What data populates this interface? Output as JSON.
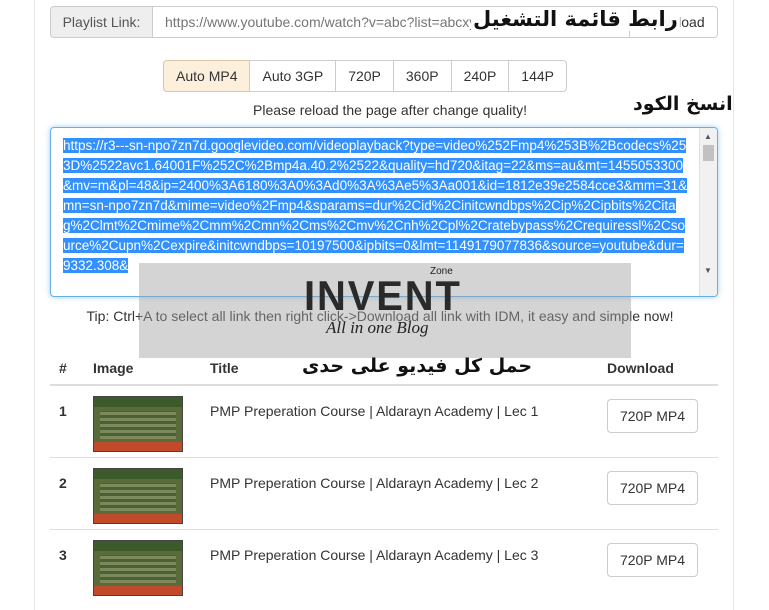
{
  "playlist": {
    "label": "Playlist Link:",
    "placeholder": "https://www.youtube.com/watch?v=abc?list=abcxyz",
    "download_label": "Download"
  },
  "quality": {
    "options": [
      "Auto MP4",
      "Auto 3GP",
      "720P",
      "360P",
      "240P",
      "144P"
    ],
    "selected": "Auto MP4"
  },
  "reload_note": "Please reload the page after change quality!",
  "code_text": "https://r3---sn-npo7zn7d.googlevideo.com/videoplayback?type=video%252Fmp4%253B%2Bcodecs%253D%2522avc1.64001F%252C%2Bmp4a.40.2%2522&quality=hd720&itag=22&ms=au&mt=1455053300&mv=m&pl=48&ip=2400%3A6180%3A0%3Ad0%3A%3Ae5%3Aa001&id=1812e39e2584cce3&mm=31&mn=sn-npo7zn7d&mime=video%2Fmp4&sparams=dur%2Cid%2Cinitcwndbps%2Cip%2Cipbits%2Citag%2Clmt%2Cmime%2Cmm%2Cmn%2Cms%2Cmv%2Cnh%2Cpl%2Cratebypass%2Crequiressl%2Csource%2Cupn%2Cexpire&initcwndbps=10197500&ipbits=0&lmt=1149179077836&source=youtube&dur=9332.308&",
  "tip": "Tip: Ctrl+A to select all link then right click->Download all link with IDM, it easy and simple now!",
  "overlays": {
    "playlist_arabic": "رابط قائمة التشغيل",
    "copy_code_arabic": "انسخ الكود",
    "download_each_arabic": "حمل كل فيديو على حدى"
  },
  "watermark": {
    "zone": "Zone",
    "brand": "INVENT",
    "tagline": "All in one Blog"
  },
  "table": {
    "headers": [
      "#",
      "Image",
      "Title",
      "Download"
    ],
    "rows": [
      {
        "num": "1",
        "title": "PMP Preperation Course | Aldarayn Academy | Lec 1",
        "button": "720P MP4"
      },
      {
        "num": "2",
        "title": "PMP Preperation Course | Aldarayn Academy | Lec 2",
        "button": "720P MP4"
      },
      {
        "num": "3",
        "title": "PMP Preperation Course | Aldarayn Academy | Lec 3",
        "button": "720P MP4"
      }
    ]
  }
}
